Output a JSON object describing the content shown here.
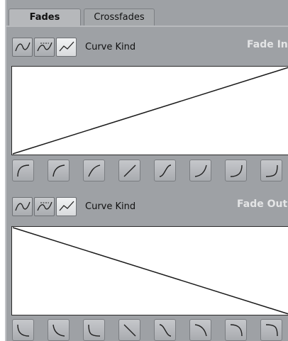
{
  "tabs": [
    {
      "label": "Fades",
      "active": true
    },
    {
      "label": "Crossfades",
      "active": false
    }
  ],
  "fade_in": {
    "title": "Fade In",
    "curve_kind_label": "Curve Kind",
    "curve_kind_buttons": [
      "spline-curve-icon",
      "damped-spline-curve-icon",
      "linear-curve-icon"
    ],
    "active_curve_kind": "linear-curve-icon",
    "presets": [
      "fade-in-curve-1-icon",
      "fade-in-curve-2-icon",
      "fade-in-curve-3-icon",
      "fade-in-linear-icon",
      "fade-in-s-curve-icon",
      "fade-in-curve-6-icon",
      "fade-in-curve-7-icon",
      "fade-in-curve-8-icon"
    ]
  },
  "fade_out": {
    "title": "Fade Out",
    "curve_kind_label": "Curve Kind",
    "curve_kind_buttons": [
      "spline-curve-icon",
      "damped-spline-curve-icon",
      "linear-curve-icon"
    ],
    "active_curve_kind": "linear-curve-icon",
    "presets": [
      "fade-out-curve-1-icon",
      "fade-out-curve-2-icon",
      "fade-out-curve-3-icon",
      "fade-out-linear-icon",
      "fade-out-s-curve-icon",
      "fade-out-curve-6-icon",
      "fade-out-curve-7-icon",
      "fade-out-curve-8-icon"
    ]
  },
  "colors": {
    "panel_bg": "#9ea1a5",
    "graph_bg": "#ffffff",
    "curve": "#1a1a1a"
  }
}
